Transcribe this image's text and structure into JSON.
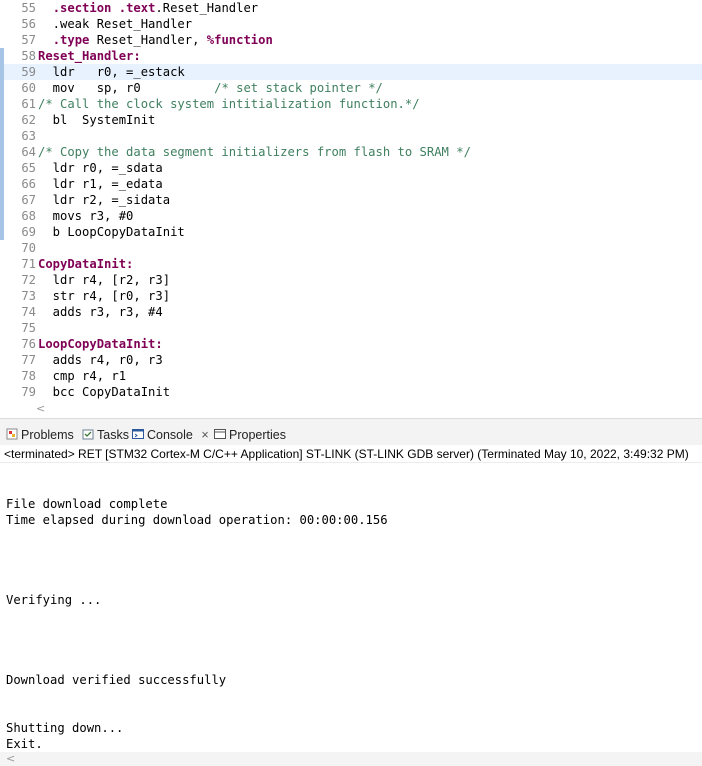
{
  "editor": {
    "lines": [
      {
        "num": "55",
        "parts": [
          {
            "t": "  "
          },
          {
            "t": ".section",
            "c": "kw"
          },
          {
            "t": " "
          },
          {
            "t": ".text",
            "c": "kw"
          },
          {
            "t": ".Reset_Handler"
          }
        ]
      },
      {
        "num": "56",
        "parts": [
          {
            "t": "  .weak Reset_Handler"
          }
        ]
      },
      {
        "num": "57",
        "parts": [
          {
            "t": "  "
          },
          {
            "t": ".type",
            "c": "kw"
          },
          {
            "t": " Reset_Handler, "
          },
          {
            "t": "%function",
            "c": "kw"
          }
        ]
      },
      {
        "num": "58",
        "parts": [
          {
            "t": "Reset_Handler:",
            "c": "lbl"
          }
        ]
      },
      {
        "num": "59",
        "parts": [
          {
            "t": "  ldr   r0, =_estack"
          }
        ]
      },
      {
        "num": "60",
        "parts": [
          {
            "t": "  mov   sp, r0          "
          },
          {
            "t": "/* set stack pointer */",
            "c": "c"
          }
        ]
      },
      {
        "num": "61",
        "parts": [
          {
            "t": "/* Call the clock system intitialization function.*/",
            "c": "c"
          }
        ]
      },
      {
        "num": "62",
        "parts": [
          {
            "t": "  bl  SystemInit"
          }
        ]
      },
      {
        "num": "63",
        "parts": [
          {
            "t": ""
          }
        ]
      },
      {
        "num": "64",
        "parts": [
          {
            "t": "/* Copy the data segment initializers from flash to SRAM */",
            "c": "c"
          }
        ]
      },
      {
        "num": "65",
        "parts": [
          {
            "t": "  ldr r0, =_sdata"
          }
        ]
      },
      {
        "num": "66",
        "parts": [
          {
            "t": "  ldr r1, =_edata"
          }
        ]
      },
      {
        "num": "67",
        "parts": [
          {
            "t": "  ldr r2, =_sidata"
          }
        ]
      },
      {
        "num": "68",
        "parts": [
          {
            "t": "  movs r3, #0"
          }
        ]
      },
      {
        "num": "69",
        "parts": [
          {
            "t": "  b LoopCopyDataInit"
          }
        ]
      },
      {
        "num": "70",
        "parts": [
          {
            "t": ""
          }
        ]
      },
      {
        "num": "71",
        "parts": [
          {
            "t": "CopyDataInit:",
            "c": "lbl"
          }
        ]
      },
      {
        "num": "72",
        "parts": [
          {
            "t": "  ldr r4, [r2, r3]"
          }
        ]
      },
      {
        "num": "73",
        "parts": [
          {
            "t": "  str r4, [r0, r3]"
          }
        ]
      },
      {
        "num": "74",
        "parts": [
          {
            "t": "  adds r3, r3, #4"
          }
        ]
      },
      {
        "num": "75",
        "parts": [
          {
            "t": ""
          }
        ]
      },
      {
        "num": "76",
        "parts": [
          {
            "t": "LoopCopyDataInit:",
            "c": "lbl"
          }
        ]
      },
      {
        "num": "77",
        "parts": [
          {
            "t": "  adds r4, r0, r3"
          }
        ]
      },
      {
        "num": "78",
        "parts": [
          {
            "t": "  cmp r4, r1"
          }
        ]
      },
      {
        "num": "79",
        "parts": [
          {
            "t": "  bcc CopyDataInit"
          }
        ]
      }
    ],
    "scroll_arrow": "<"
  },
  "tabs": {
    "problems": "Problems",
    "tasks": "Tasks",
    "console": "Console",
    "console_close": "×",
    "properties": "Properties"
  },
  "console": {
    "status": "<terminated> RET [STM32 Cortex-M C/C++ Application] ST-LINK (ST-LINK GDB server) (Terminated May 10, 2022, 3:49:32 PM)",
    "lines": [
      "",
      "",
      "File download complete",
      "Time elapsed during download operation: 00:00:00.156",
      "",
      "",
      "",
      "",
      "Verifying ...",
      "",
      "",
      "",
      "",
      "Download verified successfully",
      "",
      "",
      "Shutting down...",
      "Exit."
    ],
    "scroll_arrow": "<"
  },
  "colors": {
    "keyword": "#7f0055",
    "comment": "#3f7f5f",
    "current_line": "#e8f2fe",
    "change_gutter": "#a6c4e6"
  }
}
